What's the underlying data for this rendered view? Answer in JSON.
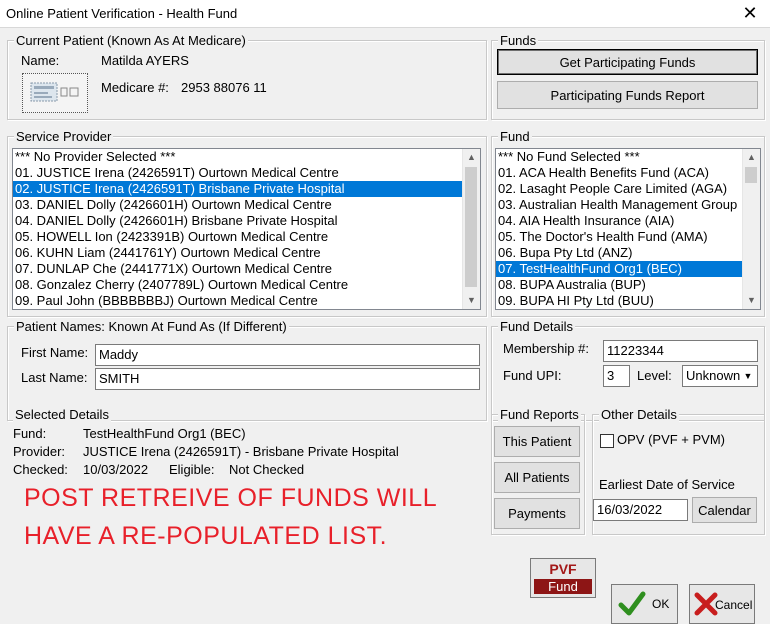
{
  "window": {
    "title": "Online Patient Verification - Health Fund",
    "close": "✕"
  },
  "current_patient": {
    "legend": "Current Patient  (Known As At Medicare)",
    "name_label": "Name:",
    "name_value": "Matilda AYERS",
    "medicare_label": "Medicare #:",
    "medicare_value": "2953 88076 11"
  },
  "funds": {
    "legend": "Funds",
    "get_button": "Get Participating Funds",
    "report_button": "Participating Funds Report"
  },
  "service_provider": {
    "legend": "Service Provider",
    "items": [
      "*** No Provider Selected ***",
      "01. JUSTICE Irena (2426591T) Ourtown Medical Centre",
      "02. JUSTICE Irena (2426591T) Brisbane Private Hospital",
      "03. DANIEL Dolly (2426601H) Ourtown Medical Centre",
      "04. DANIEL Dolly (2426601H) Brisbane Private Hospital",
      "05. HOWELL Ion (2423391B) Ourtown Medical Centre",
      "06. KUHN Liam (2441761Y) Ourtown Medical Centre",
      "07. DUNLAP Che (2441771X) Ourtown Medical Centre",
      "08. Gonzalez Cherry (2407789L) Ourtown Medical Centre",
      "09. Paul John (BBBBBBBJ) Ourtown Medical Centre"
    ],
    "selected_index": 2
  },
  "fund": {
    "legend": "Fund",
    "items": [
      "*** No Fund Selected ***",
      "01. ACA Health Benefits Fund (ACA)",
      "02. Lasaght People Care Limited (AGA)",
      "03. Australian Health Management Group",
      "04. AIA Health Insurance (AIA)",
      "05. The Doctor's Health Fund (AMA)",
      "06. Bupa Pty Ltd (ANZ)",
      "07. TestHealthFund Org1 (BEC)",
      "08. BUPA Australia (BUP)",
      "09. BUPA HI Pty Ltd (BUU)"
    ],
    "selected_index": 7
  },
  "patient_names": {
    "legend": "Patient Names: Known At Fund As  (If Different)",
    "first_label": "First Name:",
    "first_value": "Maddy",
    "last_label": "Last Name:",
    "last_value": "SMITH"
  },
  "fund_details": {
    "legend": "Fund Details",
    "membership_label": "Membership #:",
    "membership_value": "11223344",
    "upi_label": "Fund UPI:",
    "upi_value": "3",
    "level_label": "Level:",
    "level_value": "Unknown"
  },
  "selected_details": {
    "legend": "Selected Details",
    "fund_label": "Fund:",
    "fund_value": "TestHealthFund Org1  (BEC)",
    "provider_label": "Provider:",
    "provider_value": "JUSTICE Irena (2426591T) - Brisbane Private Hospital",
    "checked_label": "Checked:",
    "checked_value": "10/03/2022",
    "eligible_label": "Eligible:",
    "eligible_value": "Not Checked"
  },
  "note": {
    "line1": "POST RETREIVE OF FUNDS WILL",
    "line2": "HAVE A RE-POPULATED LIST."
  },
  "fund_reports": {
    "legend": "Fund Reports",
    "this_patient": "This Patient",
    "all_patients": "All Patients",
    "payments": "Payments"
  },
  "other_details": {
    "legend": "Other Details",
    "opv_label": "OPV (PVF + PVM)",
    "earliest_label": "Earliest Date of Service",
    "earliest_value": "16/03/2022",
    "calendar_button": "Calendar"
  },
  "footer": {
    "pvf_top": "PVF",
    "pvf_bottom": "Fund",
    "ok": "OK",
    "cancel": "Cancel"
  }
}
